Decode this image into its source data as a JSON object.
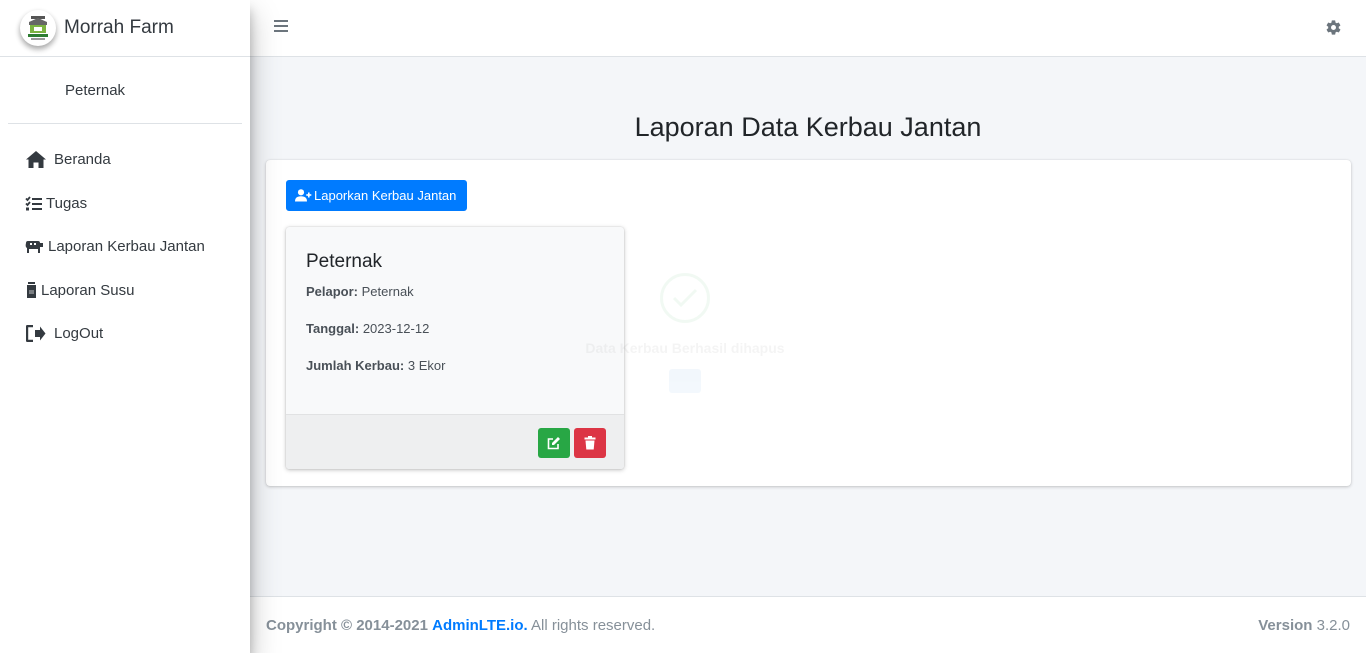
{
  "brand": {
    "name": "Morrah Farm",
    "logo_icon": "farm-logo-icon"
  },
  "user": {
    "name": "Peternak"
  },
  "sidebar": {
    "items": [
      {
        "label": "Beranda",
        "icon": "home-icon"
      },
      {
        "label": "Tugas",
        "icon": "tasks-icon"
      },
      {
        "label": "Laporan Kerbau Jantan",
        "icon": "buffalo-icon"
      },
      {
        "label": "Laporan Susu",
        "icon": "milk-icon"
      },
      {
        "label": "LogOut",
        "icon": "logout-icon"
      }
    ]
  },
  "header": {
    "menu_icon": "hamburger-icon",
    "settings_icon": "gear-icon"
  },
  "main": {
    "title": "Laporan Data Kerbau Jantan",
    "add_button_label": "Laporkan Kerbau Jantan",
    "report_card": {
      "title": "Peternak",
      "fields": [
        {
          "label": "Pelapor:",
          "value": "Peternak"
        },
        {
          "label": "Tanggal:",
          "value": "2023-12-12"
        },
        {
          "label": "Jumlah Kerbau:",
          "value": "3 Ekor"
        }
      ]
    },
    "alert": {
      "message": "Data Kerbau Berhasil dihapus"
    }
  },
  "footer": {
    "copyright": "Copyright © 2014-2021",
    "link": "AdminLTE.io.",
    "rights": "All rights reserved.",
    "version_label": "Version",
    "version_value": "3.2.0"
  },
  "colors": {
    "primary": "#007bff",
    "success": "#28a745",
    "danger": "#dc3545"
  }
}
